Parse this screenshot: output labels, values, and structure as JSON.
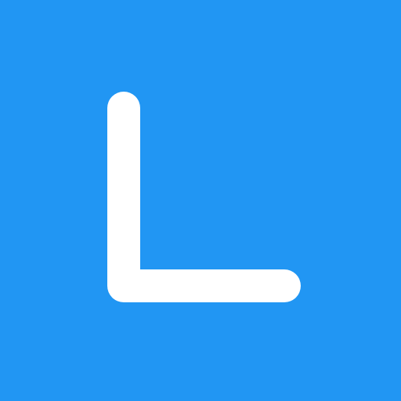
{
  "icon": {
    "name": "letter-l-logo-icon",
    "glyph": "L",
    "background_color": "#2196f3",
    "glyph_color": "#ffffff"
  }
}
